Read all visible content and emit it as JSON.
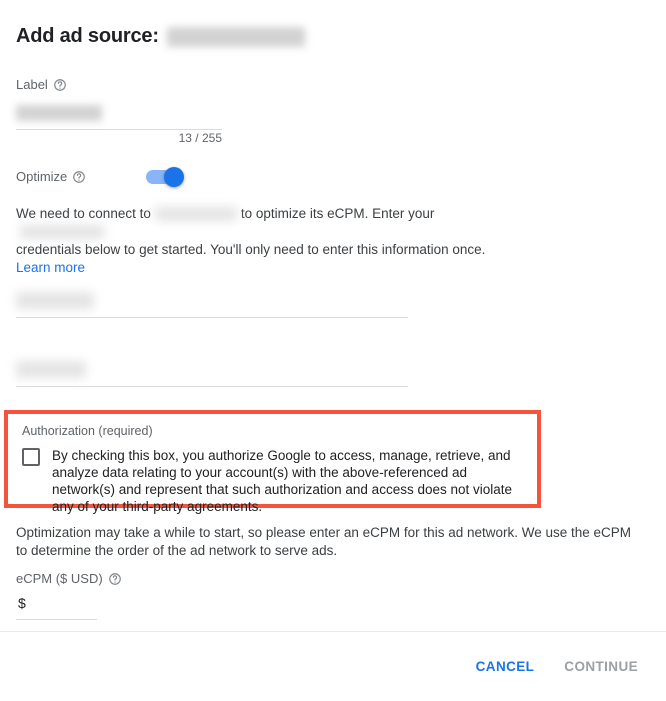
{
  "dialog": {
    "title_prefix": "Add ad source:",
    "title_redacted_value": ""
  },
  "label_field": {
    "label": "Label",
    "help_icon": "help-circle-icon",
    "value": "",
    "placeholder": "",
    "counter": "13 / 255"
  },
  "optimize": {
    "label": "Optimize",
    "help_icon": "help-circle-icon",
    "enabled": true,
    "toggle_on_color": "#1a73e8",
    "toggle_track_color": "#8ab4f8"
  },
  "description": {
    "part1": "We need to connect to",
    "redacted1": "",
    "part2": "to optimize its eCPM. Enter your",
    "redacted2": "",
    "part3": "credentials below to get started. You'll only need to enter this information once.",
    "link_text": "Learn more",
    "link_color": "#1a73e8"
  },
  "credentials": {
    "field1_value": "",
    "field2_value": ""
  },
  "authorization": {
    "legend": "Authorization (required)",
    "checked": false,
    "consent_text": "By checking this box, you authorize Google to access, manage, retrieve, and analyze data relating to your account(s) with the above-referenced ad network(s) and represent that such authorization and access does not violate any of your third-party agreements.",
    "highlight_color": "#f4543c"
  },
  "ecpm": {
    "note": "Optimization may take a while to start, so please enter an eCPM for this ad network. We use the eCPM to determine the order of the ad network to serve ads.",
    "label": "eCPM ($ USD)",
    "help_icon": "help-circle-icon",
    "currency_prefix": "$",
    "value": "",
    "placeholder": ""
  },
  "footer": {
    "cancel_label": "CANCEL",
    "continue_label": "CONTINUE",
    "cancel_color": "#1a73e8",
    "continue_color": "#9aa0a6"
  }
}
